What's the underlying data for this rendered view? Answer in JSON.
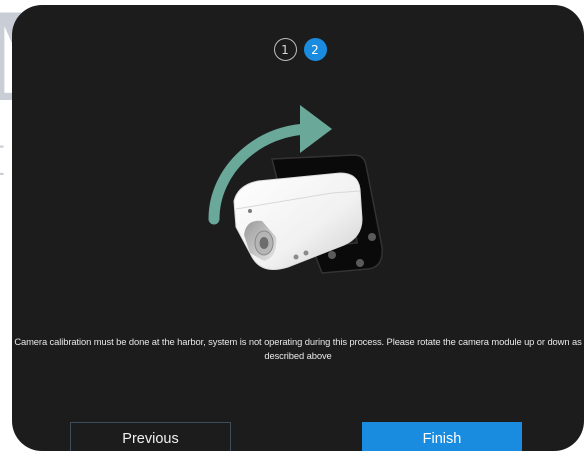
{
  "wizard": {
    "steps": [
      {
        "label": "1",
        "state": "completed"
      },
      {
        "label": "2",
        "state": "current"
      }
    ],
    "current_step": 2
  },
  "main": {
    "instructions": "Camera calibration must be done at the harbor, system is not operating during this process. Please rotate the camera module up or down as described above",
    "illustration_icon": "camera-module-rotate-illustration"
  },
  "footer": {
    "previous_label": "Previous",
    "finish_label": "Finish"
  },
  "colors": {
    "background": "#1c1c1c",
    "accent": "#1a8ce0",
    "arrow": "#6aa89a"
  }
}
